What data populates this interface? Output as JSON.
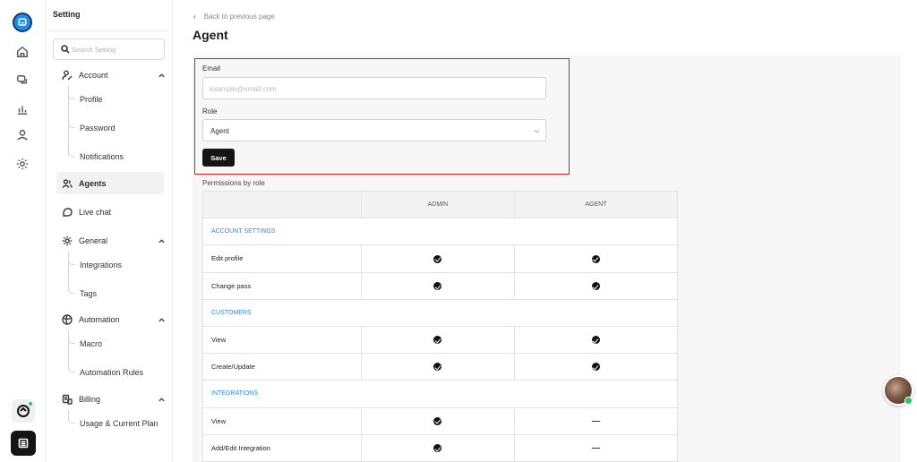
{
  "sidebar": {
    "title": "Setting",
    "search_placeholder": "Search Setting",
    "groups": [
      {
        "label": "Account",
        "icon": "user-pen-icon",
        "items": [
          "Profile",
          "Password",
          "Notifications"
        ]
      },
      {
        "label": "Agents",
        "icon": "users-icon",
        "items": []
      },
      {
        "label": "Live chat",
        "icon": "chat-bubble-icon",
        "items": []
      },
      {
        "label": "General",
        "icon": "gear-icon",
        "items": [
          "Integrations",
          "Tags"
        ]
      },
      {
        "label": "Automation",
        "icon": "automation-icon",
        "items": [
          "Macro",
          "Automation Rules"
        ]
      },
      {
        "label": "Billing",
        "icon": "billing-icon",
        "items": [
          "Usage & Current Plan"
        ]
      }
    ],
    "active": "Agents"
  },
  "main": {
    "back_label": "Back to previous page",
    "page_title": "Agent",
    "form": {
      "email_label": "Email",
      "email_placeholder": "example@email.com",
      "role_label": "Role",
      "role_value": "Agent",
      "save_label": "Save"
    },
    "permissions": {
      "label": "Permissions by role",
      "columns": [
        "ADMIN",
        "AGENT"
      ],
      "sections": [
        {
          "title": "ACCOUNT SETTINGS",
          "rows": [
            {
              "name": "Edit profile",
              "admin": "check",
              "agent": "check"
            },
            {
              "name": "Change pass",
              "admin": "check",
              "agent": "check"
            }
          ]
        },
        {
          "title": "CUSTOMERS",
          "rows": [
            {
              "name": "View",
              "admin": "check",
              "agent": "check"
            },
            {
              "name": "Create/Update",
              "admin": "check",
              "agent": "check"
            }
          ]
        },
        {
          "title": "INTEGRATIONS",
          "rows": [
            {
              "name": "View",
              "admin": "check",
              "agent": "dash"
            },
            {
              "name": "Add/Edit Integration",
              "admin": "check",
              "agent": "dash"
            }
          ]
        }
      ]
    }
  },
  "colors": {
    "accent": "#2d8ae0",
    "highlight": "#d91c1c",
    "online": "#27c46a"
  }
}
